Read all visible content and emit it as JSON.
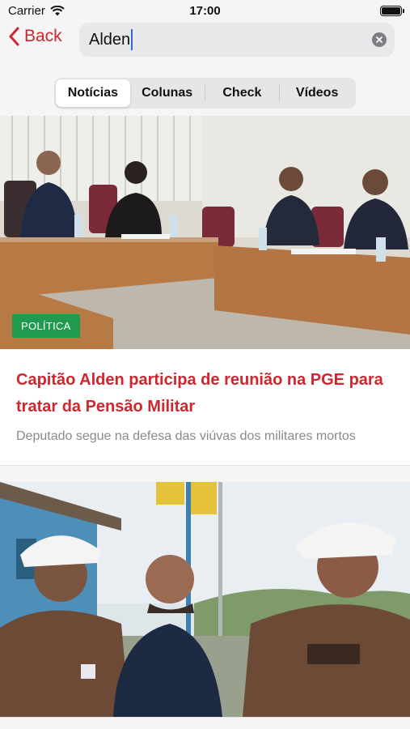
{
  "status": {
    "carrier": "Carrier",
    "time": "17:00"
  },
  "nav": {
    "back_label": "Back",
    "search_value": "Alden"
  },
  "tabs": [
    {
      "label": "Notícias",
      "active": true
    },
    {
      "label": "Colunas",
      "active": false
    },
    {
      "label": "Check",
      "active": false
    },
    {
      "label": "Vídeos",
      "active": false
    }
  ],
  "articles": [
    {
      "category": "POLÍTICA",
      "title": "Capitão Alden participa de reunião na PGE para tratar da Pensão Militar",
      "subtitle": "Deputado segue na defesa das viúvas dos militares mortos"
    }
  ],
  "colors": {
    "accent": "#d0262d",
    "badge": "#1f9a4e"
  }
}
